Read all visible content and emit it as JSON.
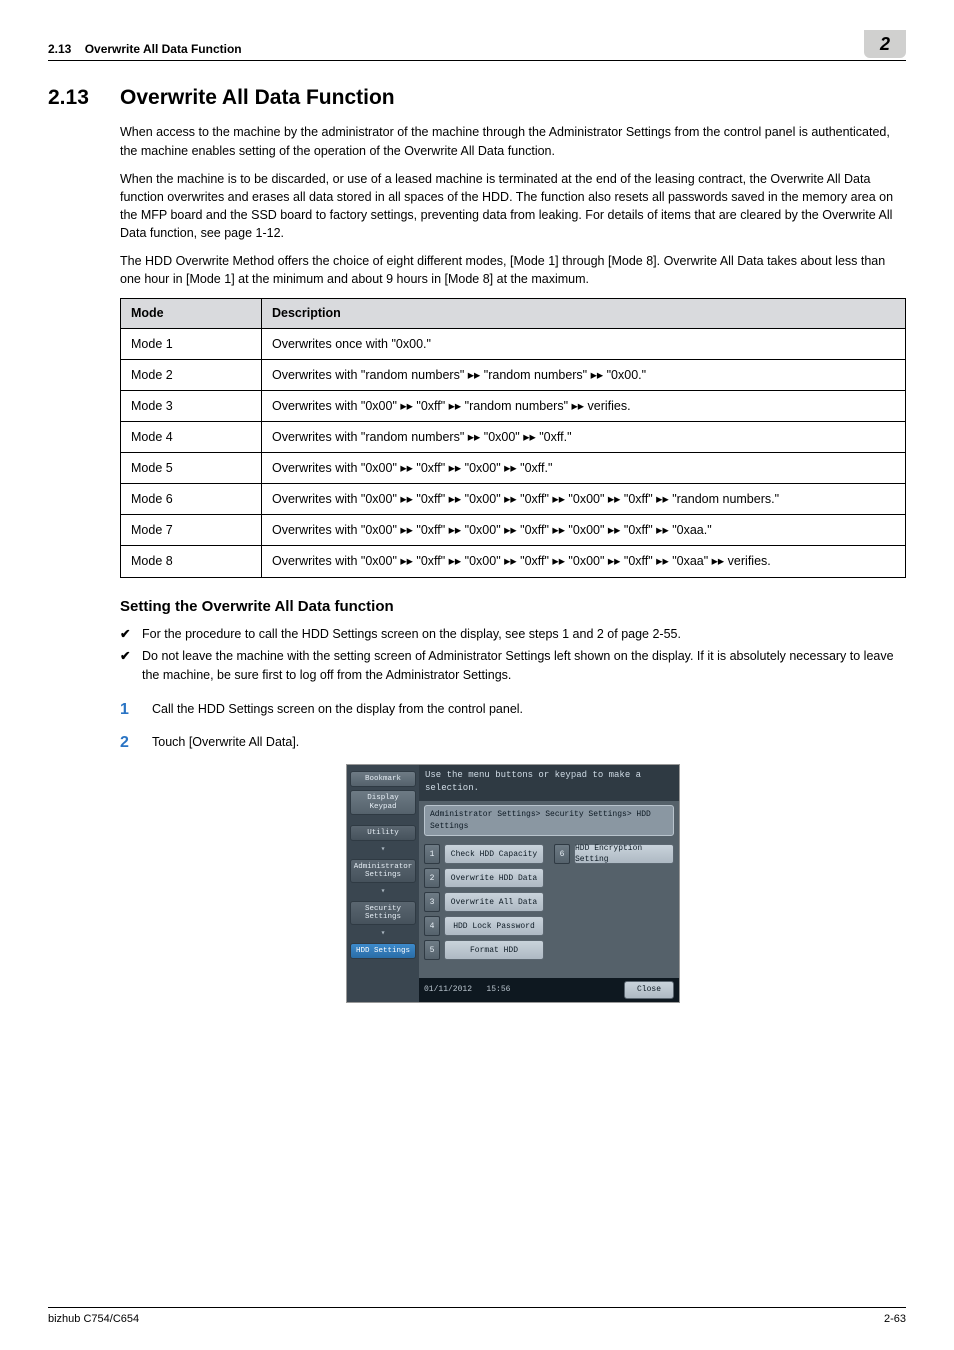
{
  "header": {
    "section_no": "2.13",
    "header_title": "Overwrite All Data Function",
    "tab": "2"
  },
  "title": {
    "num": "2.13",
    "text": "Overwrite All Data Function"
  },
  "paras": {
    "p1": "When access to the machine by the administrator of the machine through the Administrator Settings from the control panel is authenticated, the machine enables setting of the operation of the Overwrite All Data function.",
    "p2": "When the machine is to be discarded, or use of a leased machine is terminated at the end of the leasing contract, the Overwrite All Data function overwrites and erases all data stored in all spaces of the HDD. The function also resets all passwords saved in the memory area on the MFP board and the SSD board to factory settings, preventing data from leaking. For details of items that are cleared by the Overwrite All Data function, see page 1-12.",
    "p3": "The HDD Overwrite Method offers the choice of eight different modes, [Mode 1] through [Mode 8]. Overwrite All Data takes about less than one hour in [Mode 1] at the minimum and about 9 hours in [Mode 8] at the maximum."
  },
  "table": {
    "head_mode": "Mode",
    "head_desc": "Description",
    "rows": [
      {
        "m": "Mode 1",
        "d": "Overwrites once with \"0x00.\""
      },
      {
        "m": "Mode 2",
        "d": "Overwrites with \"random numbers\" ▸▸ \"random numbers\" ▸▸ \"0x00.\""
      },
      {
        "m": "Mode 3",
        "d": "Overwrites with \"0x00\" ▸▸ \"0xff\" ▸▸ \"random numbers\" ▸▸ verifies."
      },
      {
        "m": "Mode 4",
        "d": "Overwrites with \"random numbers\" ▸▸ \"0x00\" ▸▸ \"0xff.\""
      },
      {
        "m": "Mode 5",
        "d": "Overwrites with \"0x00\" ▸▸ \"0xff\" ▸▸ \"0x00\" ▸▸ \"0xff.\""
      },
      {
        "m": "Mode 6",
        "d": "Overwrites with \"0x00\" ▸▸ \"0xff\" ▸▸ \"0x00\" ▸▸ \"0xff\" ▸▸ \"0x00\" ▸▸ \"0xff\" ▸▸ \"random numbers.\""
      },
      {
        "m": "Mode 7",
        "d": "Overwrites with \"0x00\" ▸▸ \"0xff\" ▸▸ \"0x00\" ▸▸ \"0xff\" ▸▸ \"0x00\" ▸▸ \"0xff\" ▸▸ \"0xaa.\""
      },
      {
        "m": "Mode 8",
        "d": "Overwrites with \"0x00\" ▸▸ \"0xff\" ▸▸ \"0x00\" ▸▸ \"0xff\" ▸▸ \"0x00\" ▸▸ \"0xff\" ▸▸ \"0xaa\" ▸▸ verifies."
      }
    ]
  },
  "sub": {
    "title": "Setting the Overwrite All Data function",
    "checks": [
      "For the procedure to call the HDD Settings screen on the display, see steps 1 and 2 of page 2-55.",
      "Do not leave the machine with the setting screen of Administrator Settings left shown on the display. If it is absolutely necessary to leave the machine, be sure first to log off from the Administrator Settings."
    ],
    "steps": [
      {
        "n": "1",
        "t": "Call the HDD Settings screen on the display from the control panel."
      },
      {
        "n": "2",
        "t": "Touch [Overwrite All Data]."
      }
    ]
  },
  "shot": {
    "top": "Use the menu buttons or keypad to make a selection.",
    "side": {
      "bookmark": "Bookmark",
      "keypad": "Display Keypad",
      "utility": "Utility",
      "admin": "Administrator Settings",
      "security": "Security Settings",
      "hdd": "HDD Settings"
    },
    "crumb": "Administrator Settings> Security Settings> HDD Settings",
    "opts": [
      {
        "n": "1",
        "l": "Check HDD Capacity"
      },
      {
        "n": "2",
        "l": "Overwrite HDD Data"
      },
      {
        "n": "3",
        "l": "Overwrite All Data"
      },
      {
        "n": "4",
        "l": "HDD Lock Password"
      },
      {
        "n": "5",
        "l": "Format HDD"
      },
      {
        "n": "6",
        "l": "HDD Encryption Setting"
      }
    ],
    "date": "01/11/2012",
    "time": "15:56",
    "close": "Close"
  },
  "footer": {
    "left": "bizhub C754/C654",
    "right": "2-63"
  }
}
